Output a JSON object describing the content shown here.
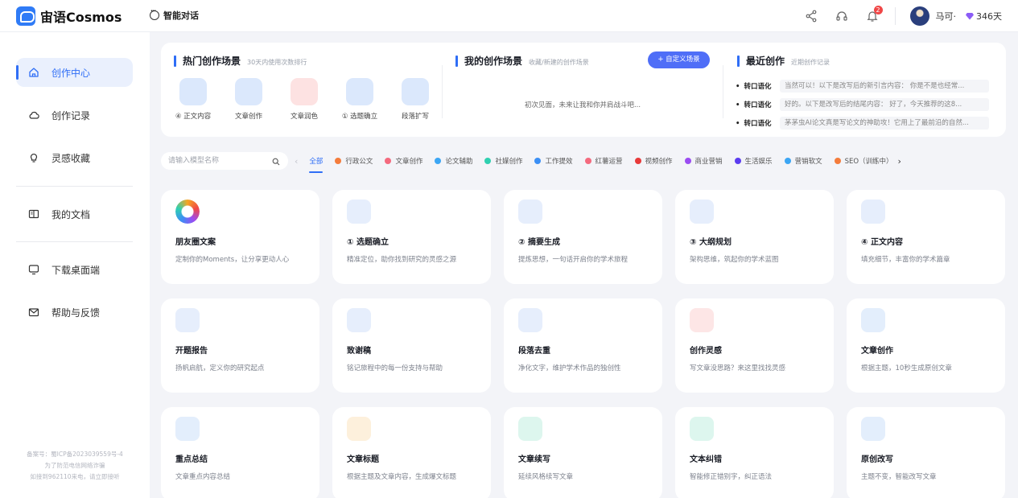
{
  "app": {
    "logo_text": "宙语Cosmos",
    "chat_tab": "智能对话"
  },
  "header": {
    "user_name": "马可·",
    "vip_days": "346天",
    "notification_count": "2",
    "icons": [
      "share-icon",
      "headset-icon",
      "bell-icon"
    ]
  },
  "sidebar": {
    "items": [
      {
        "label": "创作中心",
        "icon": "home-icon",
        "active": true
      },
      {
        "label": "创作记录",
        "icon": "cloud-icon"
      },
      {
        "label": "灵感收藏",
        "icon": "lightbulb-icon"
      },
      {
        "label": "我的文档",
        "icon": "book-icon"
      },
      {
        "label": "下载桌面端",
        "icon": "monitor-icon"
      },
      {
        "label": "帮助与反馈",
        "icon": "mail-icon"
      }
    ],
    "footer": [
      "备案号：蜀ICP备2023039559号-4",
      "为了防范电信网络诈骗",
      "如接到962110来电，请立即接听"
    ]
  },
  "hot": {
    "title": "热门创作场景",
    "subtitle": "30天内使用次数排行",
    "items": [
      {
        "label": "④ 正文内容",
        "color": "#dbe8fc"
      },
      {
        "label": "文章创作",
        "color": "#dbe8fc"
      },
      {
        "label": "文章润色",
        "color": "#fde2e2"
      },
      {
        "label": "① 选题确立",
        "color": "#dbe8fc"
      },
      {
        "label": "段落扩写",
        "color": "#dbe8fc"
      }
    ]
  },
  "mine": {
    "title": "我的创作场景",
    "subtitle": "收藏/新建的创作场景",
    "button": "+ 自定义场景",
    "empty": "初次见面，未来让我和你并肩战斗吧..."
  },
  "recent": {
    "title": "最近创作",
    "subtitle": "近期创作记录",
    "items": [
      {
        "tag": "转口语化",
        "text": "当然可以！以下是改写后的新引言内容：  你是不是也经常..."
      },
      {
        "tag": "转口语化",
        "text": "好的。以下是改写后的结尾内容：  好了，今天推荐的这8..."
      },
      {
        "tag": "转口语化",
        "text": "茅茅虫AI论文真是写论文的神助攻！它用上了最前沿的自然..."
      }
    ]
  },
  "search": {
    "placeholder": "请输入模型名称"
  },
  "categories": [
    {
      "label": "全部",
      "active": true
    },
    {
      "label": "行政公文",
      "color": "#f47c3c"
    },
    {
      "label": "文章创作",
      "color": "#f46a7e"
    },
    {
      "label": "论文辅助",
      "color": "#3ca6f4"
    },
    {
      "label": "社媒创作",
      "color": "#2fd0b0"
    },
    {
      "label": "工作提效",
      "color": "#3b8ff5"
    },
    {
      "label": "红薯运营",
      "color": "#f46a7e"
    },
    {
      "label": "视频创作",
      "color": "#e83a3a"
    },
    {
      "label": "商业营销",
      "color": "#9b4cf2"
    },
    {
      "label": "生活娱乐",
      "color": "#5b3cf0"
    },
    {
      "label": "营销软文",
      "color": "#3ca6f4"
    },
    {
      "label": "SEO（训练中）",
      "color": "#f47c3c"
    }
  ],
  "cards": [
    {
      "title": "朋友圈文案",
      "desc": "定制你的Moments，让分享更动人心",
      "color": "#f6f0ff"
    },
    {
      "title": "① 选题确立",
      "desc": "精准定位，助你找到研究的灵感之源",
      "color": "#e6eefc"
    },
    {
      "title": "② 摘要生成",
      "desc": "提炼思想，一句话开启你的学术旅程",
      "color": "#e6eefc"
    },
    {
      "title": "③ 大纲规划",
      "desc": "架构思维，筑起你的学术蓝图",
      "color": "#e6eefc"
    },
    {
      "title": "④ 正文内容",
      "desc": "填充细节，丰富你的学术篇章",
      "color": "#e6eefc"
    },
    {
      "title": "开题报告",
      "desc": "扬帆启航，定义你的研究起点",
      "color": "#e6eefc"
    },
    {
      "title": "致谢稿",
      "desc": "铭记旅程中的每一份支持与帮助",
      "color": "#e6eefc"
    },
    {
      "title": "段落去重",
      "desc": "净化文字，维护学术作品的独创性",
      "color": "#e6eefc"
    },
    {
      "title": "创作灵感",
      "desc": "写文章没思路？来这里找找灵感",
      "color": "#fde6e6"
    },
    {
      "title": "文章创作",
      "desc": "根据主题，10秒生成原创文章",
      "color": "#e3eefc"
    },
    {
      "title": "重点总结",
      "desc": "文章重点内容总结",
      "color": "#e3eefc"
    },
    {
      "title": "文章标题",
      "desc": "根据主题及文章内容，生成爆文标题",
      "color": "#fdf0dc"
    },
    {
      "title": "文章续写",
      "desc": "延续风格续写文章",
      "color": "#ddf6ee"
    },
    {
      "title": "文本纠错",
      "desc": "智能修正错别字，纠正语法",
      "color": "#ddf6ee"
    },
    {
      "title": "原创改写",
      "desc": "主题不变，智能改写文章",
      "color": "#e3eefc"
    }
  ]
}
